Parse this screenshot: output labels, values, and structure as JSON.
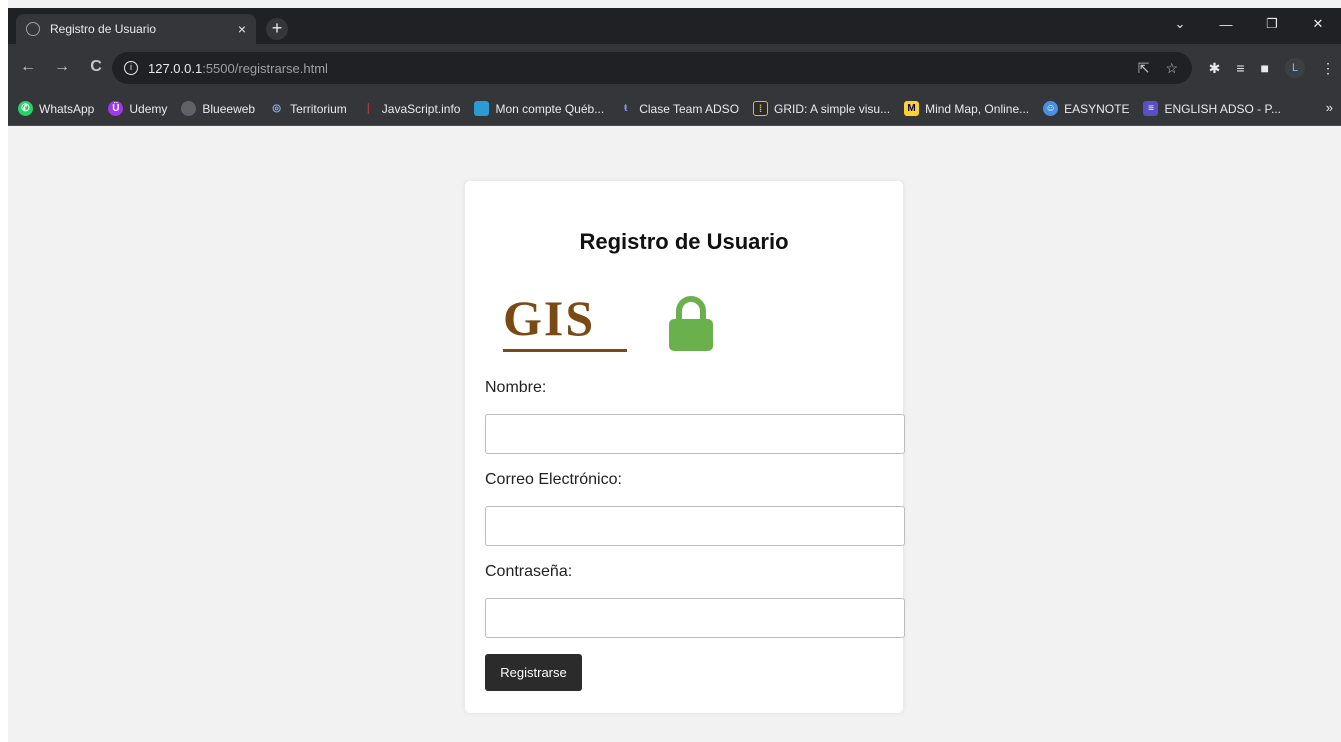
{
  "browser": {
    "tab_title": "Registro de Usuario",
    "tab_close": "×",
    "new_tab": "+",
    "url_host": "127.0.0.1",
    "url_path": ":5500/registrarse.html",
    "nav": {
      "back": "←",
      "forward": "→",
      "reload": "C"
    },
    "window": {
      "dropdown": "⌄",
      "minimize": "—",
      "restore": "❐",
      "close": "✕"
    },
    "profile_initial": "L",
    "bookmarks_more": "»"
  },
  "bookmarks": [
    {
      "label": "WhatsApp",
      "icon": "whatsapp-icon",
      "color": "#25d366"
    },
    {
      "label": "Udemy",
      "icon": "udemy-icon",
      "color": "#a435f0"
    },
    {
      "label": "Blueeweb",
      "icon": "globe-icon",
      "color": "#5f6368"
    },
    {
      "label": "Territorium",
      "icon": "territorium-icon",
      "color": "#1a73e8"
    },
    {
      "label": "JavaScript.info",
      "icon": "javascript-info-icon",
      "color": "#c0392b"
    },
    {
      "label": "Mon compte Québ...",
      "icon": "quebec-icon",
      "color": "#2b9bd6"
    },
    {
      "label": "Clase Team ADSO",
      "icon": "teams-icon",
      "color": "#6264a7"
    },
    {
      "label": "GRID: A simple visu...",
      "icon": "grid-icon",
      "color": "#e0c020"
    },
    {
      "label": "Mind Map, Online...",
      "icon": "miro-icon",
      "color": "#ffd02f"
    },
    {
      "label": "EASYNOTE",
      "icon": "easynote-icon",
      "color": "#4a90e2"
    },
    {
      "label": "ENGLISH ADSO - P...",
      "icon": "forms-icon",
      "color": "#5b4fc7"
    }
  ],
  "form": {
    "title": "Registro de Usuario",
    "logo_text": "GIS",
    "fields": [
      {
        "label": "Nombre:",
        "value": "",
        "type": "text"
      },
      {
        "label": "Correo Electrónico:",
        "value": "",
        "type": "email"
      },
      {
        "label": "Contraseña:",
        "value": "",
        "type": "password"
      }
    ],
    "submit_label": "Registrarse"
  },
  "colors": {
    "page_bg": "#f2f2f2",
    "card_bg": "#ffffff",
    "logo_brown": "#7a4a15",
    "lock_green": "#6ab04c",
    "button_bg": "#2b2b2b"
  }
}
